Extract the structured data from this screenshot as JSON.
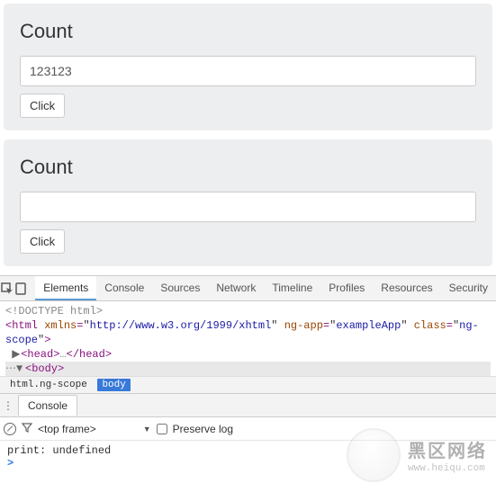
{
  "panel1": {
    "heading": "Count",
    "value": "123123",
    "button": "Click"
  },
  "panel2": {
    "heading": "Count",
    "value": "",
    "button": "Click"
  },
  "devtools": {
    "tabs": [
      "Elements",
      "Console",
      "Sources",
      "Network",
      "Timeline",
      "Profiles",
      "Resources",
      "Security"
    ],
    "active_tab": "Elements",
    "source": {
      "doctype": "<!DOCTYPE html>",
      "html_open_prefix": "<html ",
      "attr_xmlns_name": "xmlns",
      "attr_xmlns_val": "http://www.w3.org/1999/xhtml",
      "attr_ngapp_name": "ng-app",
      "attr_ngapp_val": "exampleApp",
      "attr_class_name": "class",
      "attr_class_val": "ng-scope",
      "html_open_suffix": ">",
      "head_line": "<head>…</head>",
      "body_open": "<body>"
    },
    "breadcrumb": [
      "html.ng-scope",
      "body"
    ],
    "drawer_tab": "Console",
    "console_bar": {
      "context": "<top frame>",
      "preserve_label": "Preserve log"
    },
    "console_output": "print: undefined"
  },
  "watermark": {
    "title": "黑区网络",
    "url": "www.heiqu.com"
  }
}
